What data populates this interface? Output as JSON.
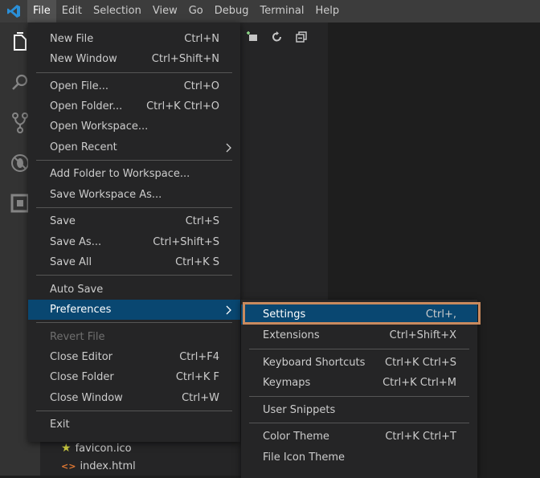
{
  "menubar": {
    "items": [
      "File",
      "Edit",
      "Selection",
      "View",
      "Go",
      "Debug",
      "Terminal",
      "Help"
    ]
  },
  "activitybar": {
    "icons": [
      "files-icon",
      "search-icon",
      "source-control-icon",
      "debug-icon",
      "extensions-icon"
    ]
  },
  "explorer": {
    "tools": [
      "new-file-icon",
      "refresh-icon",
      "collapse-all-icon"
    ],
    "files": [
      {
        "name": "favicon.ico",
        "icon": "star-icon"
      },
      {
        "name": "index.html",
        "icon": "html-code-icon"
      }
    ]
  },
  "file_menu": {
    "items": {
      "new_file": {
        "label": "New File",
        "kb": "Ctrl+N"
      },
      "new_window": {
        "label": "New Window",
        "kb": "Ctrl+Shift+N"
      },
      "open_file": {
        "label": "Open File...",
        "kb": "Ctrl+O"
      },
      "open_folder": {
        "label": "Open Folder...",
        "kb": "Ctrl+K Ctrl+O"
      },
      "open_workspace": {
        "label": "Open Workspace...",
        "kb": ""
      },
      "open_recent": {
        "label": "Open Recent",
        "kb": ""
      },
      "add_folder": {
        "label": "Add Folder to Workspace...",
        "kb": ""
      },
      "save_workspace_as": {
        "label": "Save Workspace As...",
        "kb": ""
      },
      "save": {
        "label": "Save",
        "kb": "Ctrl+S"
      },
      "save_as": {
        "label": "Save As...",
        "kb": "Ctrl+Shift+S"
      },
      "save_all": {
        "label": "Save All",
        "kb": "Ctrl+K S"
      },
      "auto_save": {
        "label": "Auto Save",
        "kb": ""
      },
      "preferences": {
        "label": "Preferences",
        "kb": ""
      },
      "revert_file": {
        "label": "Revert File",
        "kb": ""
      },
      "close_editor": {
        "label": "Close Editor",
        "kb": "Ctrl+F4"
      },
      "close_folder": {
        "label": "Close Folder",
        "kb": "Ctrl+K F"
      },
      "close_window": {
        "label": "Close Window",
        "kb": "Ctrl+W"
      },
      "exit": {
        "label": "Exit",
        "kb": ""
      }
    }
  },
  "preferences_menu": {
    "items": {
      "settings": {
        "label": "Settings",
        "kb": "Ctrl+,"
      },
      "extensions": {
        "label": "Extensions",
        "kb": "Ctrl+Shift+X"
      },
      "keyboard_shortcuts": {
        "label": "Keyboard Shortcuts",
        "kb": "Ctrl+K Ctrl+S"
      },
      "keymaps": {
        "label": "Keymaps",
        "kb": "Ctrl+K Ctrl+M"
      },
      "user_snippets": {
        "label": "User Snippets",
        "kb": ""
      },
      "color_theme": {
        "label": "Color Theme",
        "kb": "Ctrl+K Ctrl+T"
      },
      "file_icon_theme": {
        "label": "File Icon Theme",
        "kb": ""
      }
    }
  },
  "colors": {
    "selection": "#094771",
    "highlight": "#c98a5e",
    "menubar": "#3c3c3c",
    "activitybar": "#333333"
  }
}
